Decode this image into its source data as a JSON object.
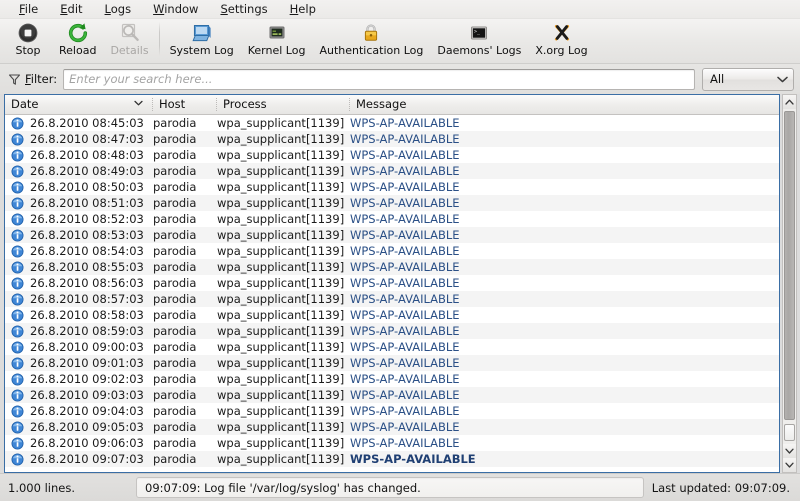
{
  "menubar": {
    "items": [
      {
        "label": "File",
        "accel": "F",
        "name": "menu-file"
      },
      {
        "label": "Edit",
        "accel": "E",
        "name": "menu-edit"
      },
      {
        "label": "Logs",
        "accel": "L",
        "name": "menu-logs"
      },
      {
        "label": "Window",
        "accel": "W",
        "name": "menu-window"
      },
      {
        "label": "Settings",
        "accel": "S",
        "name": "menu-settings"
      },
      {
        "label": "Help",
        "accel": "H",
        "name": "menu-help"
      }
    ]
  },
  "toolbar": {
    "buttons": [
      {
        "label": "Stop",
        "icon": "stop-icon",
        "name": "toolbar-stop",
        "disabled": false
      },
      {
        "label": "Reload",
        "icon": "reload-icon",
        "name": "toolbar-reload",
        "disabled": false
      },
      {
        "label": "Details",
        "icon": "details-magnifier-icon",
        "name": "toolbar-details",
        "disabled": true
      },
      {
        "label": "System Log",
        "icon": "system-log-monitor-icon",
        "name": "toolbar-system-log",
        "disabled": false
      },
      {
        "label": "Kernel Log",
        "icon": "kernel-log-screen-icon",
        "name": "toolbar-kernel-log",
        "disabled": false
      },
      {
        "label": "Authentication Log",
        "icon": "padlock-icon",
        "name": "toolbar-authentication-log",
        "disabled": false
      },
      {
        "label": "Daemons' Logs",
        "icon": "terminal-icon",
        "name": "toolbar-daemons-logs",
        "disabled": false
      },
      {
        "label": "X.org Log",
        "icon": "xorg-icon",
        "name": "toolbar-xorg-log",
        "disabled": false
      }
    ]
  },
  "filter": {
    "label": "F",
    "label_rest": "ilter:",
    "placeholder": "Enter your search here...",
    "value": "",
    "icon": "funnel-icon",
    "dropdown_value": "All",
    "dropdown_icon": "chevron-down-icon"
  },
  "table": {
    "columns": [
      {
        "label": "Date",
        "name": "column-header-date",
        "sorted": true,
        "sort_icon": "chevron-down-icon"
      },
      {
        "label": "Host",
        "name": "column-header-host",
        "sorted": false
      },
      {
        "label": "Process",
        "name": "column-header-process",
        "sorted": false
      },
      {
        "label": "Message",
        "name": "column-header-message",
        "sorted": false
      }
    ],
    "rows": [
      {
        "icon": "info-icon",
        "date": "26.8.2010 08:45:03",
        "host": "parodia",
        "process": "wpa_supplicant[1139]",
        "message": "WPS-AP-AVAILABLE",
        "bold": false
      },
      {
        "icon": "info-icon",
        "date": "26.8.2010 08:47:03",
        "host": "parodia",
        "process": "wpa_supplicant[1139]",
        "message": "WPS-AP-AVAILABLE",
        "bold": false
      },
      {
        "icon": "info-icon",
        "date": "26.8.2010 08:48:03",
        "host": "parodia",
        "process": "wpa_supplicant[1139]",
        "message": "WPS-AP-AVAILABLE",
        "bold": false
      },
      {
        "icon": "info-icon",
        "date": "26.8.2010 08:49:03",
        "host": "parodia",
        "process": "wpa_supplicant[1139]",
        "message": "WPS-AP-AVAILABLE",
        "bold": false
      },
      {
        "icon": "info-icon",
        "date": "26.8.2010 08:50:03",
        "host": "parodia",
        "process": "wpa_supplicant[1139]",
        "message": "WPS-AP-AVAILABLE",
        "bold": false
      },
      {
        "icon": "info-icon",
        "date": "26.8.2010 08:51:03",
        "host": "parodia",
        "process": "wpa_supplicant[1139]",
        "message": "WPS-AP-AVAILABLE",
        "bold": false
      },
      {
        "icon": "info-icon",
        "date": "26.8.2010 08:52:03",
        "host": "parodia",
        "process": "wpa_supplicant[1139]",
        "message": "WPS-AP-AVAILABLE",
        "bold": false
      },
      {
        "icon": "info-icon",
        "date": "26.8.2010 08:53:03",
        "host": "parodia",
        "process": "wpa_supplicant[1139]",
        "message": "WPS-AP-AVAILABLE",
        "bold": false
      },
      {
        "icon": "info-icon",
        "date": "26.8.2010 08:54:03",
        "host": "parodia",
        "process": "wpa_supplicant[1139]",
        "message": "WPS-AP-AVAILABLE",
        "bold": false
      },
      {
        "icon": "info-icon",
        "date": "26.8.2010 08:55:03",
        "host": "parodia",
        "process": "wpa_supplicant[1139]",
        "message": "WPS-AP-AVAILABLE",
        "bold": false
      },
      {
        "icon": "info-icon",
        "date": "26.8.2010 08:56:03",
        "host": "parodia",
        "process": "wpa_supplicant[1139]",
        "message": "WPS-AP-AVAILABLE",
        "bold": false
      },
      {
        "icon": "info-icon",
        "date": "26.8.2010 08:57:03",
        "host": "parodia",
        "process": "wpa_supplicant[1139]",
        "message": "WPS-AP-AVAILABLE",
        "bold": false
      },
      {
        "icon": "info-icon",
        "date": "26.8.2010 08:58:03",
        "host": "parodia",
        "process": "wpa_supplicant[1139]",
        "message": "WPS-AP-AVAILABLE",
        "bold": false
      },
      {
        "icon": "info-icon",
        "date": "26.8.2010 08:59:03",
        "host": "parodia",
        "process": "wpa_supplicant[1139]",
        "message": "WPS-AP-AVAILABLE",
        "bold": false
      },
      {
        "icon": "info-icon",
        "date": "26.8.2010 09:00:03",
        "host": "parodia",
        "process": "wpa_supplicant[1139]",
        "message": "WPS-AP-AVAILABLE",
        "bold": false
      },
      {
        "icon": "info-icon",
        "date": "26.8.2010 09:01:03",
        "host": "parodia",
        "process": "wpa_supplicant[1139]",
        "message": "WPS-AP-AVAILABLE",
        "bold": false
      },
      {
        "icon": "info-icon",
        "date": "26.8.2010 09:02:03",
        "host": "parodia",
        "process": "wpa_supplicant[1139]",
        "message": "WPS-AP-AVAILABLE",
        "bold": false
      },
      {
        "icon": "info-icon",
        "date": "26.8.2010 09:03:03",
        "host": "parodia",
        "process": "wpa_supplicant[1139]",
        "message": "WPS-AP-AVAILABLE",
        "bold": false
      },
      {
        "icon": "info-icon",
        "date": "26.8.2010 09:04:03",
        "host": "parodia",
        "process": "wpa_supplicant[1139]",
        "message": "WPS-AP-AVAILABLE",
        "bold": false
      },
      {
        "icon": "info-icon",
        "date": "26.8.2010 09:05:03",
        "host": "parodia",
        "process": "wpa_supplicant[1139]",
        "message": "WPS-AP-AVAILABLE",
        "bold": false
      },
      {
        "icon": "info-icon",
        "date": "26.8.2010 09:06:03",
        "host": "parodia",
        "process": "wpa_supplicant[1139]",
        "message": "WPS-AP-AVAILABLE",
        "bold": false
      },
      {
        "icon": "info-icon",
        "date": "26.8.2010 09:07:03",
        "host": "parodia",
        "process": "wpa_supplicant[1139]",
        "message": "WPS-AP-AVAILABLE",
        "bold": true
      }
    ]
  },
  "scrollbar": {
    "up_icon": "chevron-up-icon",
    "down_icon": "chevron-down-icon",
    "extra_down_icon": "chevron-down-icon"
  },
  "statusbar": {
    "lines": "1.000 lines.",
    "message": "09:07:09: Log file '/var/log/syslog' has changed.",
    "last_updated": "Last updated: 09:07:09."
  },
  "colors": {
    "message_link": "#2a4f86",
    "frame_border": "#3a6ea5",
    "window_bg": "#dcdcdc",
    "row_alt": "#f4f4f4"
  }
}
